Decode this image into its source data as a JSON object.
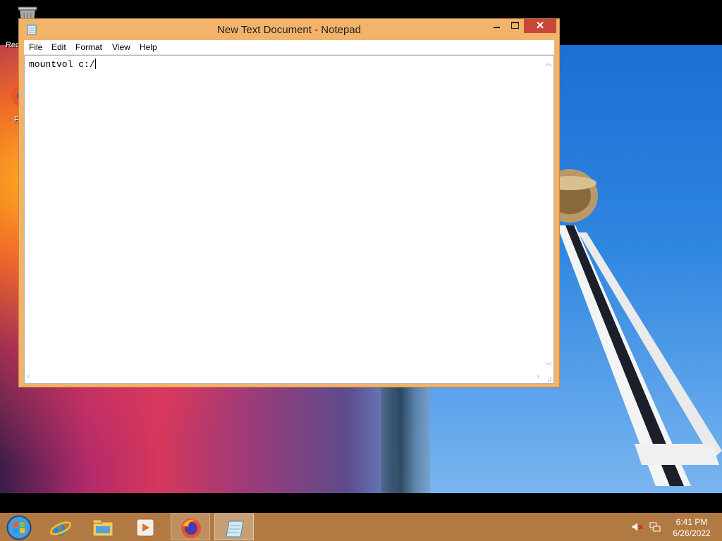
{
  "desktop": {
    "recycle_bin_label": "Recycle Bin",
    "firefox_label": "Firefox"
  },
  "window": {
    "title": "New Text Document - Notepad",
    "close_glyph": "✕",
    "menu": [
      "File",
      "Edit",
      "Format",
      "View",
      "Help"
    ],
    "content": "mountvol c:/"
  },
  "taskbar": {
    "items": [
      "start-icon",
      "internet-explorer-icon",
      "file-explorer-icon",
      "media-player-icon",
      "firefox-icon",
      "notepad-icon"
    ],
    "time": "6:41 PM",
    "date": "6/26/2022"
  },
  "colors": {
    "window_frame": "#f2b36a",
    "close_button": "#c7463a",
    "taskbar": "#b27a43"
  }
}
